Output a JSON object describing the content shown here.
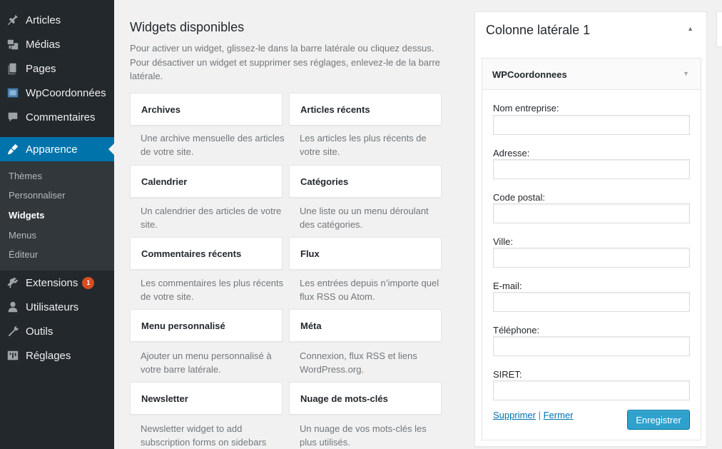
{
  "sidebar": {
    "items": [
      {
        "label": "Articles",
        "icon": "pin-icon"
      },
      {
        "label": "Médias",
        "icon": "media-icon"
      },
      {
        "label": "Pages",
        "icon": "pages-icon"
      },
      {
        "label": "WpCoordonnées",
        "icon": "coordonnees-icon"
      },
      {
        "label": "Commentaires",
        "icon": "comments-icon"
      },
      {
        "label": "Apparence",
        "icon": "appearance-icon"
      },
      {
        "label": "Extensions",
        "icon": "plugins-icon",
        "badge": "1"
      },
      {
        "label": "Utilisateurs",
        "icon": "users-icon"
      },
      {
        "label": "Outils",
        "icon": "tools-icon"
      },
      {
        "label": "Réglages",
        "icon": "settings-icon"
      }
    ],
    "submenu": [
      "Thèmes",
      "Personnaliser",
      "Widgets",
      "Menus",
      "Éditeur"
    ],
    "active_color": "#0073aa"
  },
  "main": {
    "heading": "Widgets disponibles",
    "description": "Pour activer un widget, glissez-le dans la barre latérale ou cliquez dessus. Pour désactiver un widget et supprimer ses réglages, enlevez-le de la barre latérale.",
    "widgets": [
      {
        "title": "Archives",
        "desc": "Une archive mensuelle des articles de votre site."
      },
      {
        "title": "Articles récents",
        "desc": "Les articles les plus récents de votre site."
      },
      {
        "title": "Calendrier",
        "desc": "Un calendrier des articles de votre site."
      },
      {
        "title": "Catégories",
        "desc": "Une liste ou un menu déroulant des catégories."
      },
      {
        "title": "Commentaires récents",
        "desc": "Les commentaires les plus récents de votre site."
      },
      {
        "title": "Flux",
        "desc": "Les entrées depuis n’importe quel flux RSS ou Atom."
      },
      {
        "title": "Menu personnalisé",
        "desc": "Ajouter un menu personnalisé à votre barre latérale."
      },
      {
        "title": "Méta",
        "desc": "Connexion, flux RSS et liens WordPress.org."
      },
      {
        "title": "Newsletter",
        "desc": "Newsletter widget to add subscription forms on sidebars"
      },
      {
        "title": "Nuage de mots-clés",
        "desc": "Un nuage de vos mots-clés les plus utilisés."
      }
    ]
  },
  "sidebar_column": {
    "title": "Colonne latérale 1",
    "widget": {
      "title": "WPCoordonnees",
      "fields": [
        {
          "label": "Nom entreprise:",
          "value": ""
        },
        {
          "label": "Adresse:",
          "value": ""
        },
        {
          "label": "Code postal:",
          "value": ""
        },
        {
          "label": "Ville:",
          "value": ""
        },
        {
          "label": "E-mail:",
          "value": ""
        },
        {
          "label": "Téléphone:",
          "value": ""
        },
        {
          "label": "SIRET:",
          "value": ""
        }
      ],
      "delete_label": "Supprimer",
      "separator": "|",
      "close_label": "Fermer",
      "save_label": "Enregistrer"
    }
  }
}
